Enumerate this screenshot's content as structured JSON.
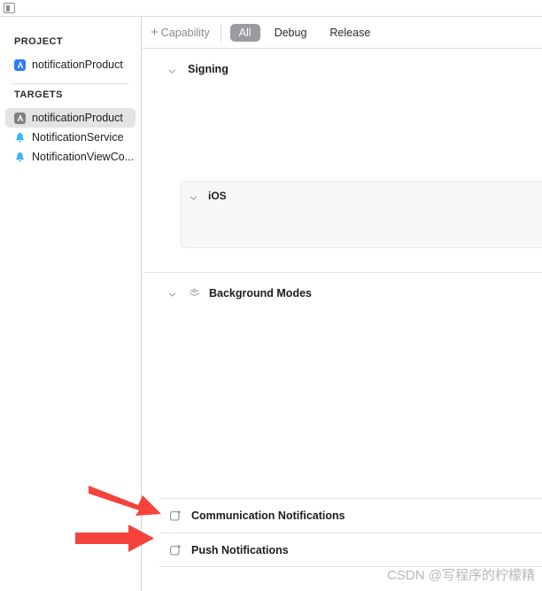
{
  "window": {
    "sidebar_toggle_icon": "sidebar-toggle-icon"
  },
  "sidebar": {
    "project_section_label": "PROJECT",
    "project_items": [
      {
        "label": "notificationProduct",
        "icon": "xcode-app-icon",
        "selected": false
      }
    ],
    "targets_section_label": "TARGETS",
    "target_items": [
      {
        "label": "notificationProduct",
        "icon": "xcode-app-icon",
        "selected": true
      },
      {
        "label": "NotificationService",
        "icon": "notification-bell-icon",
        "selected": false
      },
      {
        "label": "NotificationViewCo...",
        "icon": "notification-bell-icon",
        "selected": false
      }
    ]
  },
  "toolbar": {
    "add_capability_label": "Capability",
    "plus_glyph": "+",
    "segments": [
      {
        "label": "All",
        "active": true
      },
      {
        "label": "Debug",
        "active": false
      },
      {
        "label": "Release",
        "active": false
      }
    ]
  },
  "main": {
    "signing_section": {
      "title": "Signing",
      "chevron_icon": "chevron-down-icon"
    },
    "ios_group": {
      "title": "iOS",
      "chevron_icon": "chevron-down-icon"
    },
    "background_modes_section": {
      "title": "Background Modes",
      "chevron_icon": "chevron-down-icon",
      "icon": "background-modes-icon"
    },
    "capability_rows": [
      {
        "label": "Communication Notifications",
        "icon": "notification-badge-icon"
      },
      {
        "label": "Push Notifications",
        "icon": "notification-badge-icon"
      }
    ]
  },
  "annotations": {
    "arrow_color": "#f5433c",
    "arrows": [
      {
        "name": "arrow-pointing-communication-notifications",
        "direction": "diagonal-down-right"
      },
      {
        "name": "arrow-pointing-push-notifications",
        "direction": "right"
      }
    ]
  },
  "watermark": {
    "text": "CSDN @写程序的柠檬精"
  },
  "colors": {
    "accent_blue": "#2f7cf6",
    "selected_gray": "#e3e3e3",
    "segment_active": "#9b9b9f",
    "divider": "#dcdcdc",
    "group_box": "#f7f7f7"
  }
}
